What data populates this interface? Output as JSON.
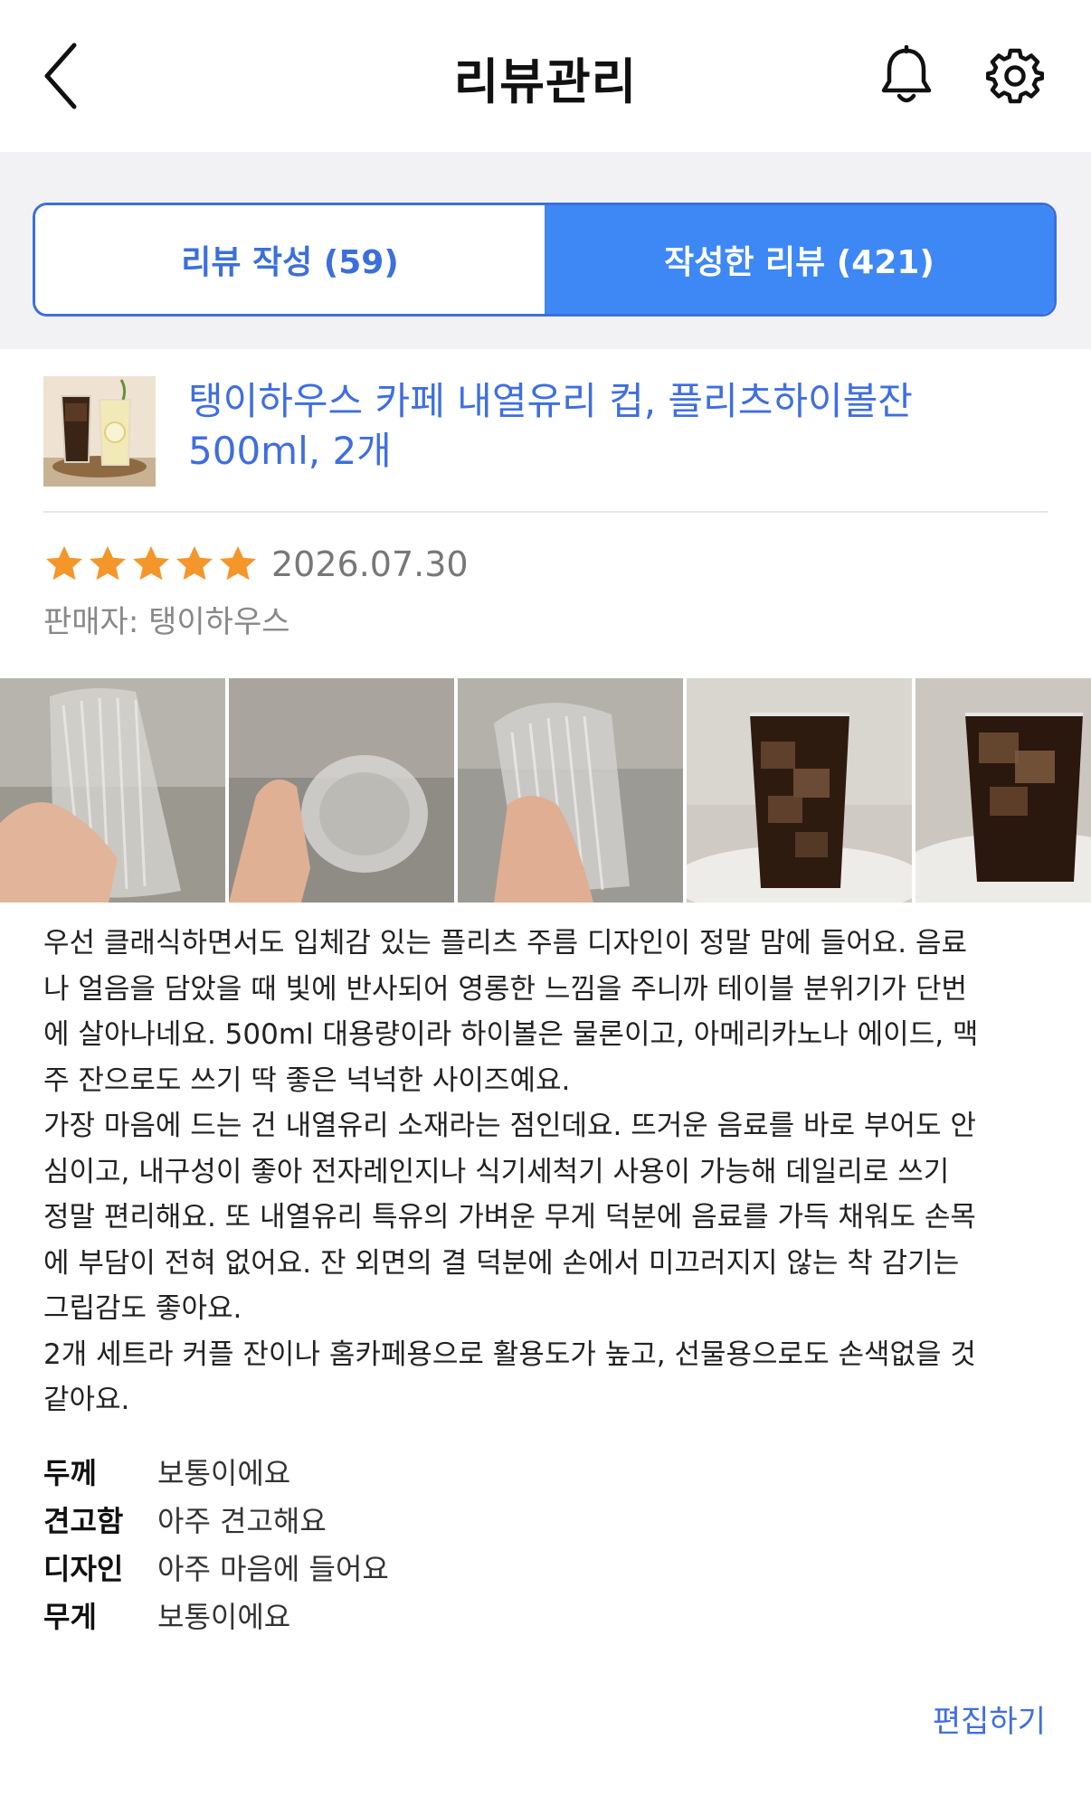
{
  "header": {
    "title": "리뷰관리",
    "back_icon": "chevron-left-icon",
    "notification_icon": "bell-icon",
    "settings_icon": "gear-icon"
  },
  "tabs": [
    {
      "label": "리뷰 작성 (59)",
      "selected": false
    },
    {
      "label": "작성한 리뷰 (421)",
      "selected": true
    }
  ],
  "review": {
    "product_name": "탱이하우스 카페 내열유리 컵, 플리츠하이볼잔 500ml, 2개",
    "rating": 5,
    "max_rating": 5,
    "date": "2026.07.30",
    "seller": "판매자: 탱이하우스",
    "photos_count": 5,
    "text": "우선 클래식하면서도 입체감 있는 플리츠 주름 디자인이 정말 맘에 들어요. 음료\n나 얼음을 담았을 때 빛에 반사되어 영롱한 느낌을 주니까 테이블 분위기가 단번\n에 살아나네요. 500ml 대용량이라 하이볼은 물론이고, 아메리카노나 에이드, 맥\n주 잔으로도 쓰기 딱 좋은 넉넉한 사이즈예요.\n가장 마음에 드는 건 내열유리 소재라는 점인데요. 뜨거운 음료를 바로 부어도 안\n심이고, 내구성이 좋아 전자레인지나 식기세척기 사용이 가능해 데일리로 쓰기\n정말 편리해요. 또 내열유리 특유의 가벼운 무게 덕분에 음료를 가득 채워도 손목\n에 부담이 전혀 없어요. 잔 외면의 결 덕분에 손에서 미끄러지지 않는 착 감기는\n그립감도 좋아요.\n2개 세트라 커플 잔이나 홈카페용으로 활용도가 높고, 선물용으로도 손색없을 것\n같아요.",
    "attributes": [
      {
        "label": "두께",
        "value": "보통이에요"
      },
      {
        "label": "견고함",
        "value": "아주 견고해요"
      },
      {
        "label": "디자인",
        "value": "아주 마음에 들어요"
      },
      {
        "label": "무게",
        "value": "보통이에요"
      }
    ],
    "edit_label": "편집하기"
  },
  "colors": {
    "accent": "#3d88f4",
    "link": "#3f6ee0",
    "star": "#f5962b"
  }
}
